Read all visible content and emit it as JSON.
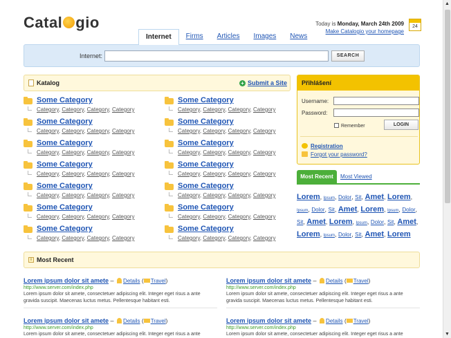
{
  "logo": {
    "before": "Catal",
    "after": "gio"
  },
  "header": {
    "today_prefix": "Today is ",
    "today_date": "Monday, March 24th 2009",
    "homepage_link": "Make Catalogio your homepage",
    "calendar_day": "24"
  },
  "tabs": [
    {
      "label": "Internet",
      "active": true
    },
    {
      "label": "Firms"
    },
    {
      "label": "Articles"
    },
    {
      "label": "Images"
    },
    {
      "label": "News"
    }
  ],
  "search": {
    "label": "Internet:",
    "value": "",
    "button": "SEARCH"
  },
  "katalog": {
    "title": "Katalog",
    "submit": "Submit a Site",
    "categories": [
      {
        "name": "Some Category",
        "subs": [
          "Category",
          "Category",
          "Category",
          "Category"
        ]
      },
      {
        "name": "Some Category",
        "subs": [
          "Category",
          "Category",
          "Category",
          "Category"
        ]
      },
      {
        "name": "Some Category",
        "subs": [
          "Category",
          "Category",
          "Category",
          "Category"
        ]
      },
      {
        "name": "Some Category",
        "subs": [
          "Category",
          "Category",
          "Category",
          "Category"
        ]
      },
      {
        "name": "Some Category",
        "subs": [
          "Category",
          "Category",
          "Category",
          "Category"
        ]
      },
      {
        "name": "Some Category",
        "subs": [
          "Category",
          "Category",
          "Category",
          "Category"
        ]
      },
      {
        "name": "Some Category",
        "subs": [
          "Category",
          "Category",
          "Category",
          "Category"
        ]
      },
      {
        "name": "Some Category",
        "subs": [
          "Category",
          "Category",
          "Category",
          "Category"
        ]
      },
      {
        "name": "Some Category",
        "subs": [
          "Category",
          "Category",
          "Category",
          "Category"
        ]
      },
      {
        "name": "Some Category",
        "subs": [
          "Category",
          "Category",
          "Category",
          "Category"
        ]
      },
      {
        "name": "Some Category",
        "subs": [
          "Category",
          "Category",
          "Category",
          "Category"
        ]
      },
      {
        "name": "Some Category",
        "subs": [
          "Category",
          "Category",
          "Category",
          "Category"
        ]
      },
      {
        "name": "Some Category",
        "subs": [
          "Category",
          "Category",
          "Category",
          "Category"
        ]
      },
      {
        "name": "Some Category",
        "subs": [
          "Category",
          "Category",
          "Category",
          "Category"
        ]
      }
    ]
  },
  "login": {
    "title": "Přihlášení",
    "username_label": "Username:",
    "password_label": "Password:",
    "username_value": "",
    "password_value": "",
    "remember": "Remember",
    "button": "LOGIN",
    "registration": "Registration",
    "forgot": "Forgot your password?"
  },
  "most_tabs": {
    "active": "Most Recent",
    "other": "Most Viewed"
  },
  "tagcloud": [
    {
      "t": "Lorem",
      "s": 3
    },
    {
      "t": "Ipsum",
      "s": 1
    },
    {
      "t": "Dolor",
      "s": 2
    },
    {
      "t": "Sit",
      "s": 2
    },
    {
      "t": "Amet",
      "s": 3
    },
    {
      "t": "Lorem",
      "s": 3
    },
    {
      "t": "Ipsum",
      "s": 1
    },
    {
      "t": "Dolor",
      "s": 2
    },
    {
      "t": "Sit",
      "s": 2
    },
    {
      "t": "Amet",
      "s": 3
    },
    {
      "t": "Lorem",
      "s": 3
    },
    {
      "t": "Ipsum",
      "s": 1
    },
    {
      "t": "Dolor",
      "s": 2
    },
    {
      "t": "Sit",
      "s": 2
    },
    {
      "t": "Amet",
      "s": 3
    },
    {
      "t": "Lorem",
      "s": 3
    },
    {
      "t": "Ipsum",
      "s": 1
    },
    {
      "t": "Dolor",
      "s": 2
    },
    {
      "t": "Sit",
      "s": 2
    },
    {
      "t": "Amet",
      "s": 3
    },
    {
      "t": "Lorem",
      "s": 3
    },
    {
      "t": "Ipsum",
      "s": 1
    },
    {
      "t": "Dolor",
      "s": 2
    },
    {
      "t": "Sit",
      "s": 2
    },
    {
      "t": "Amet",
      "s": 3
    },
    {
      "t": "Lorem",
      "s": 3
    }
  ],
  "recent": {
    "title": "Most Recent",
    "entries": [
      {
        "title": "Lorem ipsum dolor sit amete",
        "details": "Details",
        "category": "Travel",
        "url": "http://www.server.com/index.php",
        "desc": "Lorem ipsum dolor sit amete, consectetuer adipiscing elit. Integer eget risus a ante gravida suscipit. Maecenas luctus metus. Pellentesque habitant esti."
      },
      {
        "title": "Lorem ipsum dolor sit amete",
        "details": "Details",
        "category": "Travel",
        "url": "http://www.server.com/index.php",
        "desc": "Lorem ipsum dolor sit amete, consectetuer adipiscing elit. Integer eget risus a ante gravida suscipit. Maecenas luctus metus. Pellentesque habitant esti."
      },
      {
        "title": "Lorem ipsum dolor sit amete",
        "details": "Details",
        "category": "Travel",
        "url": "http://www.server.com/index.php",
        "desc": "Lorem ipsum dolor sit amete, consectetuer adipiscing elit. Integer eget risus a ante gravida suscipit. Maecenas luctus metus. Pellentesque habitant esti."
      },
      {
        "title": "Lorem ipsum dolor sit amete",
        "details": "Details",
        "category": "Travel",
        "url": "http://www.server.com/index.php",
        "desc": "Lorem ipsum dolor sit amete, consectetuer adipiscing elit. Integer eget risus a ante gravida suscipit. Maecenas luctus metus. Pellentesque habitant esti."
      }
    ]
  }
}
